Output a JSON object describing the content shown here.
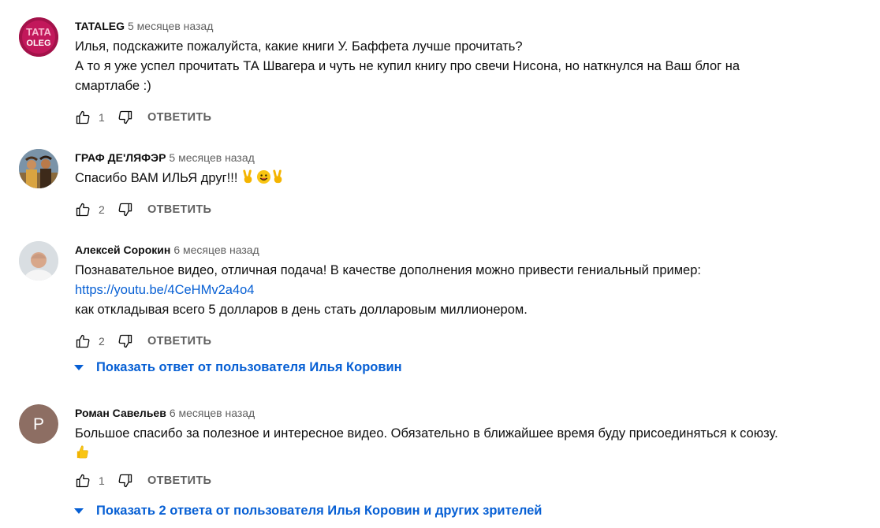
{
  "comments": [
    {
      "author": "TATALEG",
      "time": "5 месяцев назад",
      "avatar_text_top": "TATA",
      "avatar_text_bottom": "OLEG",
      "lines": [
        "Илья, подскажите пожалуйста, какие книги У. Баффета лучше прочитать?",
        "А то я уже успел прочитать ТА Швагера и чуть не купил книгу про свечи Нисона, но наткнулся на Ваш блог на",
        "смартлабе :)"
      ],
      "likes": "1",
      "reply_label": "ОТВЕТИТЬ"
    },
    {
      "author": "ГРАФ ДЕ'ЛЯФЭР",
      "time": "5 месяцев назад",
      "text": "Спасибо ВАМ ИЛЬЯ друг!!!",
      "emojis": [
        "victory-hand-emoji",
        "smiling-face-emoji",
        "victory-hand-emoji"
      ],
      "likes": "2",
      "reply_label": "ОТВЕТИТЬ"
    },
    {
      "author": "Алексей Сорокин",
      "time": "6 месяцев назад",
      "line1": "Познавательное видео, отличная подача! В качестве дополнения можно привести гениальный пример:",
      "link": "https://youtu.be/4CeHMv2a4o4",
      "line3": "как откладывая всего 5 долларов в день стать долларовым миллионером.",
      "likes": "2",
      "reply_label": "ОТВЕТИТЬ",
      "replies_label": "Показать ответ от пользователя Илья Коровин"
    },
    {
      "author": "Роман Савельев",
      "time": "6 месяцев назад",
      "avatar_letter": "Р",
      "avatar_color": "#8d6e63",
      "text": "Большое спасибо за полезное и интересное видео. Обязательно в ближайшее время буду присоединяться к союзу.",
      "emoji": "thumbs-up-emoji",
      "likes": "1",
      "reply_label": "ОТВЕТИТЬ",
      "replies_label": "Показать 2 ответа от пользователя Илья Коровин и других зрителей"
    }
  ],
  "colors": {
    "link": "#065fd4",
    "meta": "#606060",
    "text": "#0f0f0f"
  }
}
